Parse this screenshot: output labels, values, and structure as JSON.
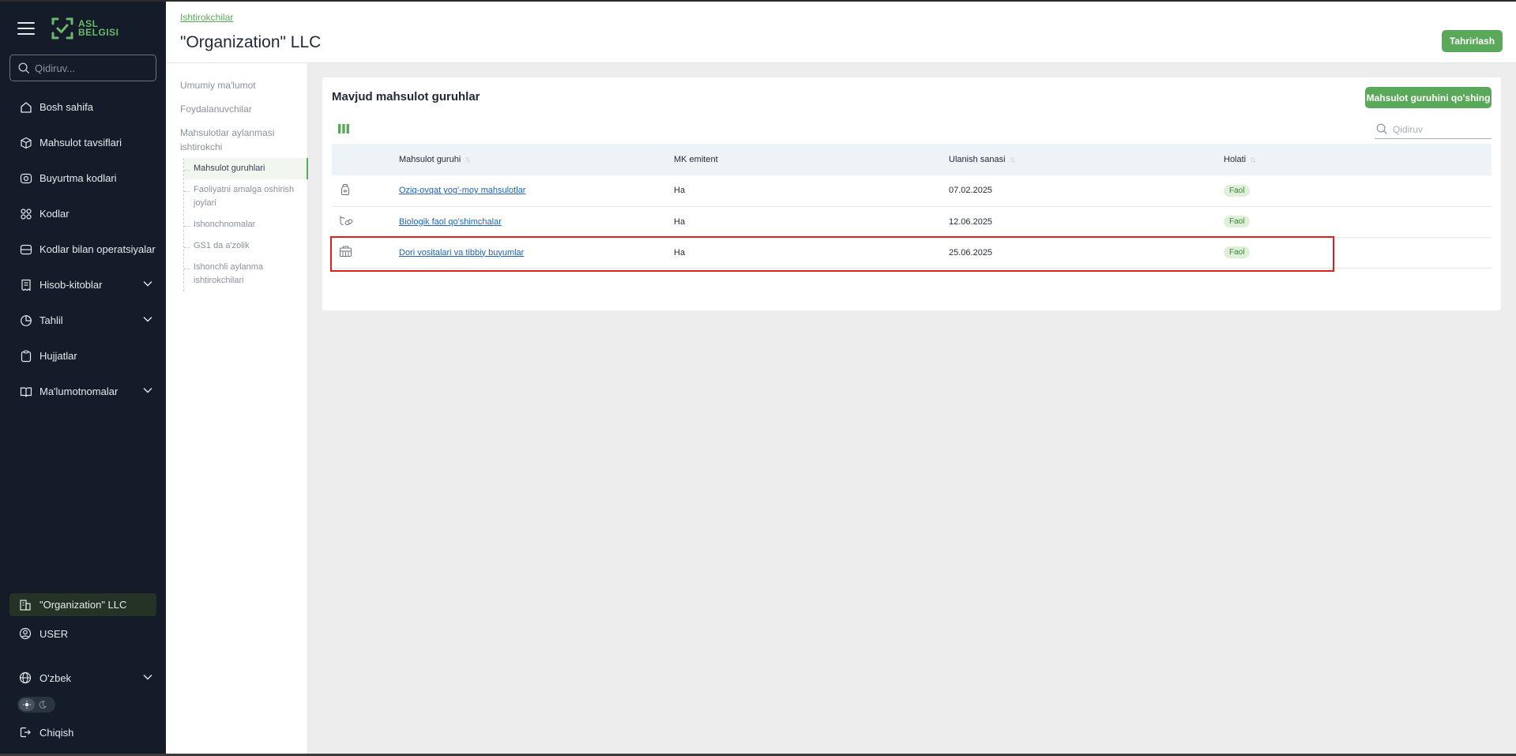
{
  "sidebar": {
    "logo_line1": "ASL",
    "logo_line2": "BELGISI",
    "search_placeholder": "Qidiruv...",
    "items": [
      {
        "label": "Bosh sahifa",
        "icon": "home-icon"
      },
      {
        "label": "Mahsulot tavsiflari",
        "icon": "box-icon"
      },
      {
        "label": "Buyurtma kodlari",
        "icon": "order-codes-icon"
      },
      {
        "label": "Kodlar",
        "icon": "codes-icon"
      },
      {
        "label": "Kodlar bilan operatsiyalar",
        "icon": "operations-icon"
      },
      {
        "label": "Hisob-kitoblar",
        "icon": "receipt-icon",
        "expandable": true
      },
      {
        "label": "Tahlil",
        "icon": "analytics-icon",
        "expandable": true
      },
      {
        "label": "Hujjatlar",
        "icon": "clipboard-icon"
      },
      {
        "label": "Ma'lumotnomalar",
        "icon": "book-icon",
        "expandable": true
      }
    ],
    "organization": "\"Organization\" LLC",
    "user": "USER",
    "language": "O'zbek",
    "logout": "Chiqish"
  },
  "header": {
    "breadcrumb": "Ishtirokchilar",
    "title": "\"Organization\" LLC",
    "edit_button": "Tahrirlash"
  },
  "subnav": {
    "general": "Umumiy ma'lumot",
    "users": "Foydalanuvchilar",
    "circulation": "Mahsulotlar aylanmasi ishtirokchi",
    "children": [
      "Mahsulot guruhlari",
      "Faoliyatni amalga oshirish joylari",
      "Ishonchnomalar",
      "GS1 da a'zolik",
      "Ishonchli aylanma ishtirokchilari"
    ]
  },
  "main": {
    "title": "Mavjud mahsulot guruhlar",
    "add_button": "Mahsulot guruhini qo'shing",
    "search_placeholder": "Qidiruv",
    "columns": [
      "Mahsulot guruhi",
      "MK emitent",
      "Ulanish sanasi",
      "Holati"
    ],
    "rows": [
      {
        "icon": "food-jar-icon",
        "name": "Oziq-ovqat yog'-moy mahsulotlar",
        "emitent": "Ha",
        "date": "07.02.2025",
        "status": "Faol"
      },
      {
        "icon": "supplements-icon",
        "name": "Biologik faol qo'shimchalar",
        "emitent": "Ha",
        "date": "12.06.2025",
        "status": "Faol"
      },
      {
        "icon": "medical-kit-icon",
        "name": "Dori vositalari va tibbiy buyumlar",
        "emitent": "Ha",
        "date": "25.06.2025",
        "status": "Faol"
      }
    ]
  },
  "colors": {
    "accent": "#5aa85a",
    "sidebar_bg": "#131c28",
    "highlight": "#e01e1e"
  }
}
